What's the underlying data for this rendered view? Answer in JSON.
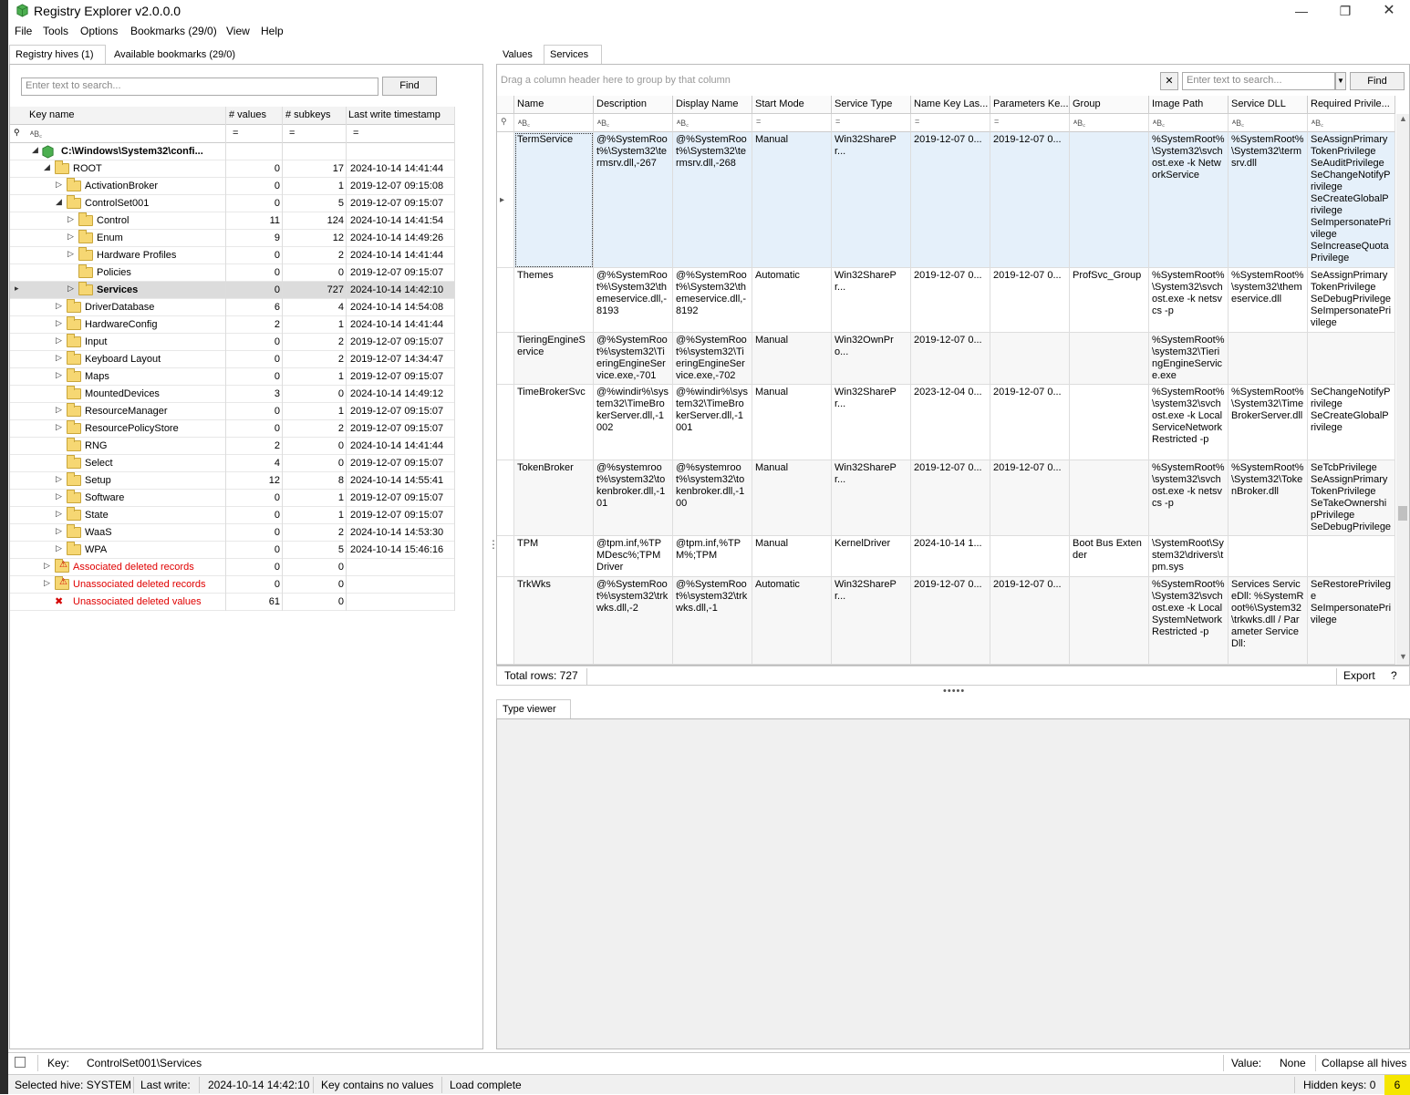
{
  "app": {
    "title": "Registry Explorer v2.0.0.0"
  },
  "menu": [
    "File",
    "Tools",
    "Options",
    "Bookmarks (29/0)",
    "View",
    "Help"
  ],
  "left_tabs": [
    "Registry hives (1)",
    "Available bookmarks (29/0)"
  ],
  "right_tabs": [
    "Values",
    "Services"
  ],
  "left_search": {
    "placeholder": "Enter text to search...",
    "find": "Find"
  },
  "tree_headers": [
    "Key name",
    "# values",
    "# subkeys",
    "Last write timestamp"
  ],
  "tree_rows": [
    {
      "name": "C:\\Windows\\System32\\confi...",
      "values": "",
      "subkeys": "",
      "ts": "",
      "level": 0,
      "exp": "◢",
      "kind": "hive",
      "bold": true
    },
    {
      "name": "ROOT",
      "values": "0",
      "subkeys": "17",
      "ts": "2024-10-14 14:41:44",
      "level": 1,
      "exp": "◢",
      "kind": "folder"
    },
    {
      "name": "ActivationBroker",
      "values": "0",
      "subkeys": "1",
      "ts": "2019-12-07 09:15:08",
      "level": 2,
      "exp": "▷",
      "kind": "folder"
    },
    {
      "name": "ControlSet001",
      "values": "0",
      "subkeys": "5",
      "ts": "2019-12-07 09:15:07",
      "level": 2,
      "exp": "◢",
      "kind": "folder"
    },
    {
      "name": "Control",
      "values": "11",
      "subkeys": "124",
      "ts": "2024-10-14 14:41:54",
      "level": 3,
      "exp": "▷",
      "kind": "folder"
    },
    {
      "name": "Enum",
      "values": "9",
      "subkeys": "12",
      "ts": "2024-10-14 14:49:26",
      "level": 3,
      "exp": "▷",
      "kind": "folder"
    },
    {
      "name": "Hardware Profiles",
      "values": "0",
      "subkeys": "2",
      "ts": "2024-10-14 14:41:44",
      "level": 3,
      "exp": "▷",
      "kind": "folder"
    },
    {
      "name": "Policies",
      "values": "0",
      "subkeys": "0",
      "ts": "2019-12-07 09:15:07",
      "level": 3,
      "exp": "",
      "kind": "folder"
    },
    {
      "name": "Services",
      "values": "0",
      "subkeys": "727",
      "ts": "2024-10-14 14:42:10",
      "level": 3,
      "exp": "▷",
      "kind": "folder",
      "bold": true,
      "selected": true
    },
    {
      "name": "DriverDatabase",
      "values": "6",
      "subkeys": "4",
      "ts": "2024-10-14 14:54:08",
      "level": 2,
      "exp": "▷",
      "kind": "folder"
    },
    {
      "name": "HardwareConfig",
      "values": "2",
      "subkeys": "1",
      "ts": "2024-10-14 14:41:44",
      "level": 2,
      "exp": "▷",
      "kind": "folder"
    },
    {
      "name": "Input",
      "values": "0",
      "subkeys": "2",
      "ts": "2019-12-07 09:15:07",
      "level": 2,
      "exp": "▷",
      "kind": "folder"
    },
    {
      "name": "Keyboard Layout",
      "values": "0",
      "subkeys": "2",
      "ts": "2019-12-07 14:34:47",
      "level": 2,
      "exp": "▷",
      "kind": "folder"
    },
    {
      "name": "Maps",
      "values": "0",
      "subkeys": "1",
      "ts": "2019-12-07 09:15:07",
      "level": 2,
      "exp": "▷",
      "kind": "folder"
    },
    {
      "name": "MountedDevices",
      "values": "3",
      "subkeys": "0",
      "ts": "2024-10-14 14:49:12",
      "level": 2,
      "exp": "",
      "kind": "folder"
    },
    {
      "name": "ResourceManager",
      "values": "0",
      "subkeys": "1",
      "ts": "2019-12-07 09:15:07",
      "level": 2,
      "exp": "▷",
      "kind": "folder"
    },
    {
      "name": "ResourcePolicyStore",
      "values": "0",
      "subkeys": "2",
      "ts": "2019-12-07 09:15:07",
      "level": 2,
      "exp": "▷",
      "kind": "folder"
    },
    {
      "name": "RNG",
      "values": "2",
      "subkeys": "0",
      "ts": "2024-10-14 14:41:44",
      "level": 2,
      "exp": "",
      "kind": "folder"
    },
    {
      "name": "Select",
      "values": "4",
      "subkeys": "0",
      "ts": "2019-12-07 09:15:07",
      "level": 2,
      "exp": "",
      "kind": "folder"
    },
    {
      "name": "Setup",
      "values": "12",
      "subkeys": "8",
      "ts": "2024-10-14 14:55:41",
      "level": 2,
      "exp": "▷",
      "kind": "folder"
    },
    {
      "name": "Software",
      "values": "0",
      "subkeys": "1",
      "ts": "2019-12-07 09:15:07",
      "level": 2,
      "exp": "▷",
      "kind": "folder"
    },
    {
      "name": "State",
      "values": "0",
      "subkeys": "1",
      "ts": "2019-12-07 09:15:07",
      "level": 2,
      "exp": "▷",
      "kind": "folder"
    },
    {
      "name": "WaaS",
      "values": "0",
      "subkeys": "2",
      "ts": "2024-10-14 14:53:30",
      "level": 2,
      "exp": "▷",
      "kind": "folder"
    },
    {
      "name": "WPA",
      "values": "0",
      "subkeys": "5",
      "ts": "2024-10-14 15:46:16",
      "level": 2,
      "exp": "▷",
      "kind": "folder"
    },
    {
      "name": "Associated deleted records",
      "values": "0",
      "subkeys": "0",
      "ts": "",
      "level": 1,
      "exp": "▷",
      "kind": "warn",
      "red": true
    },
    {
      "name": "Unassociated deleted records",
      "values": "0",
      "subkeys": "0",
      "ts": "",
      "level": 1,
      "exp": "▷",
      "kind": "warn",
      "red": true
    },
    {
      "name": "Unassociated deleted values",
      "values": "61",
      "subkeys": "0",
      "ts": "",
      "level": 1,
      "exp": "",
      "kind": "delval",
      "red": true
    }
  ],
  "grid": {
    "group_hint": "Drag a column header here to group by that column",
    "search_placeholder": "Enter text to search...",
    "find": "Find",
    "columns": [
      "Name",
      "Description",
      "Display Name",
      "Start Mode",
      "Service Type",
      "Name Key Las...",
      "Parameters Ke...",
      "Group",
      "Image Path",
      "Service DLL",
      "Required Privile..."
    ],
    "filters": [
      "ᴬB꜀",
      "ᴬB꜀",
      "ᴬB꜀",
      "=",
      "=",
      "=",
      "=",
      "ᴬB꜀",
      "ᴬB꜀",
      "ᴬB꜀",
      "ᴬB꜀"
    ],
    "rows": [
      {
        "cells": [
          "TermService",
          "@%SystemRoot%\\System32\\termsrv.dll,-267",
          "@%SystemRoot%\\System32\\termsrv.dll,-268",
          "Manual",
          "Win32SharePr...",
          "2019-12-07 0...",
          "2019-12-07 0...",
          "",
          "%SystemRoot%\\System32\\svchost.exe -k NetworkService",
          "%SystemRoot%\\System32\\termsrv.dll",
          "SeAssignPrimaryTokenPrivilege\nSeAuditPrivilege\nSeChangeNotifyPrivilege\nSeCreateGlobalPrivilege\nSeImpersonatePrivilege\nSeIncreaseQuotaPrivilege"
        ]
      },
      {
        "cells": [
          "Themes",
          "@%SystemRoot%\\System32\\themeservice.dll,-8193",
          "@%SystemRoot%\\System32\\themeservice.dll,-8192",
          "Automatic",
          "Win32SharePr...",
          "2019-12-07 0...",
          "2019-12-07 0...",
          "ProfSvc_Group",
          "%SystemRoot%\\System32\\svchost.exe -k netsvcs -p",
          "%SystemRoot%\\system32\\themeservice.dll",
          "SeAssignPrimaryTokenPrivilege\nSeDebugPrivilege\nSeImpersonatePrivilege"
        ]
      },
      {
        "cells": [
          "TieringEngineService",
          "@%SystemRoot%\\system32\\TieringEngineService.exe,-701",
          "@%SystemRoot%\\system32\\TieringEngineService.exe,-702",
          "Manual",
          "Win32OwnPro...",
          "2019-12-07 0...",
          "",
          "",
          "%SystemRoot%\\system32\\TieringEngineService.exe",
          "",
          ""
        ]
      },
      {
        "cells": [
          "TimeBrokerSvc",
          "@%windir%\\system32\\TimeBrokerServer.dll,-1002",
          "@%windir%\\system32\\TimeBrokerServer.dll,-1001",
          "Manual",
          "Win32SharePr...",
          "2023-12-04 0...",
          "2019-12-07 0...",
          "",
          "%SystemRoot%\\system32\\svchost.exe -k LocalServiceNetworkRestricted -p",
          "%SystemRoot%\\System32\\TimeBrokerServer.dll",
          "SeChangeNotifyPrivilege\nSeCreateGlobalPrivilege"
        ]
      },
      {
        "cells": [
          "TokenBroker",
          "@%systemroot%\\system32\\tokenbroker.dll,-101",
          "@%systemroot%\\system32\\tokenbroker.dll,-100",
          "Manual",
          "Win32SharePr...",
          "2019-12-07 0...",
          "2019-12-07 0...",
          "",
          "%SystemRoot%\\system32\\svchost.exe -k netsvcs -p",
          "%SystemRoot%\\System32\\TokenBroker.dll",
          "SeTcbPrivilege\nSeAssignPrimaryTokenPrivilege\nSeTakeOwnershipPrivilege\nSeDebugPrivilege"
        ]
      },
      {
        "cells": [
          "TPM",
          "@tpm.inf,%TPMDesc%;TPM Driver",
          "@tpm.inf,%TPM%;TPM",
          "Manual",
          "KernelDriver",
          "2024-10-14 1...",
          "",
          "Boot Bus Extender",
          "\\SystemRoot\\System32\\drivers\\tpm.sys",
          "",
          ""
        ]
      },
      {
        "cells": [
          "TrkWks",
          "@%SystemRoot%\\system32\\trkwks.dll,-2",
          "@%SystemRoot%\\system32\\trkwks.dll,-1",
          "Automatic",
          "Win32SharePr...",
          "2019-12-07 0...",
          "2019-12-07 0...",
          "",
          "%SystemRoot%\\System32\\svchost.exe -k LocalSystemNetworkRestricted -p",
          "Services ServiceDll: %SystemRoot%\\System32\\trkwks.dll / Parameter ServiceDll:",
          "SeRestorePrivilege\nSeImpersonatePrivilege"
        ]
      }
    ],
    "total_rows": "Total rows: 727",
    "export": "Export",
    "help": "?"
  },
  "type_viewer_tab": "Type viewer",
  "status1": {
    "key_label": "Key:",
    "key_value": "ControlSet001\\Services",
    "value_label": "Value:",
    "value_value": "None",
    "collapse": "Collapse all hives"
  },
  "status2": {
    "hive": "Selected hive: SYSTEM",
    "lastwrite_label": "Last write:",
    "lastwrite": "2024-10-14 14:42:10",
    "novalues": "Key contains no values",
    "load": "Load complete",
    "hidden": "Hidden keys: 0",
    "badge": "6"
  },
  "colors": {
    "accent": "#1e7ad8",
    "selection": "#dbe9f6",
    "badge": "#f5e600",
    "deleted": "#e00000"
  }
}
